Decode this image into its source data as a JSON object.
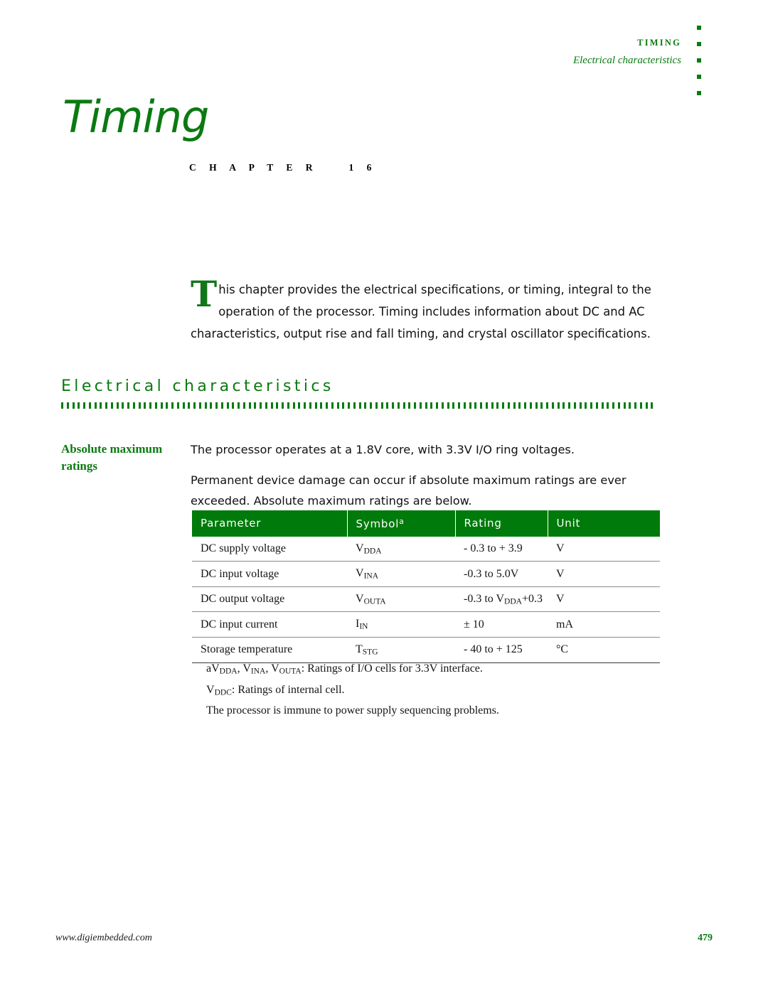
{
  "colors": {
    "brand_green": "#0a7a11",
    "table_header_green": "#007a0a",
    "body_text": "#111111"
  },
  "running_header": {
    "chapter_name": "TIMING",
    "section_name": "Electrical characteristics",
    "dot_count": 5
  },
  "chapter": {
    "title": "Timing",
    "label": "C H A P T E R    1 6"
  },
  "intro": {
    "dropcap": "T",
    "text": "his chapter provides the electrical specifications, or timing, integral to the operation of the processor. Timing includes information about DC and AC characteristics, output rise and fall timing, and crystal oscillator specifications."
  },
  "section": {
    "heading": "Electrical characteristics",
    "rule_dot_count": 108
  },
  "side_note": {
    "label": "Absolute maximum ratings"
  },
  "body": {
    "paragraph_1": "The processor operates at a 1.8V core, with 3.3V I/O ring voltages.",
    "paragraph_2": "Permanent device damage can occur if absolute maximum ratings are ever exceeded. Absolute maximum ratings are below."
  },
  "table": {
    "headers": [
      {
        "label": "Parameter",
        "footnote_marker": ""
      },
      {
        "label": "Symbol",
        "footnote_marker": "a"
      },
      {
        "label": "Rating",
        "footnote_marker": ""
      },
      {
        "label": "Unit",
        "footnote_marker": ""
      }
    ],
    "rows": [
      {
        "parameter": "DC supply voltage",
        "symbol_base": "V",
        "symbol_sub": "DDA",
        "rating_pre": "- 0.3 to + 3.9",
        "rating_sub": "",
        "rating_post": "",
        "unit": "V"
      },
      {
        "parameter": "DC input voltage",
        "symbol_base": "V",
        "symbol_sub": "INA",
        "rating_pre": "-0.3 to 5.0V",
        "rating_sub": "",
        "rating_post": "",
        "unit": "V"
      },
      {
        "parameter": "DC output voltage",
        "symbol_base": "V",
        "symbol_sub": "OUTA",
        "rating_pre": "-0.3 to V",
        "rating_sub": "DDA",
        "rating_post": "+0.3",
        "unit": "V"
      },
      {
        "parameter": "DC input current",
        "symbol_base": "I",
        "symbol_sub": "IN",
        "rating_pre": "± 10",
        "rating_sub": "",
        "rating_post": "",
        "unit": "mA"
      },
      {
        "parameter": "Storage temperature",
        "symbol_base": "T",
        "symbol_sub": "STG",
        "rating_pre": "- 40 to + 125",
        "rating_sub": "",
        "rating_post": "",
        "unit": "°C"
      }
    ]
  },
  "footnotes": {
    "line_1_marker": "a",
    "line_1_sym1_base": "V",
    "line_1_sym1_sub": "DDA",
    "line_1_sym2_base": "V",
    "line_1_sym2_sub": "INA",
    "line_1_sym3_base": "V",
    "line_1_sym3_sub": "OUTA",
    "line_1_text": ": Ratings of I/O cells for 3.3V interface.",
    "line_2_base": "V",
    "line_2_sub": "DDC",
    "line_2_text": ": Ratings of internal cell.",
    "line_3_text": "The processor is immune to power supply sequencing problems."
  },
  "footer": {
    "url": "www.digiembedded.com",
    "page_number": "479"
  }
}
